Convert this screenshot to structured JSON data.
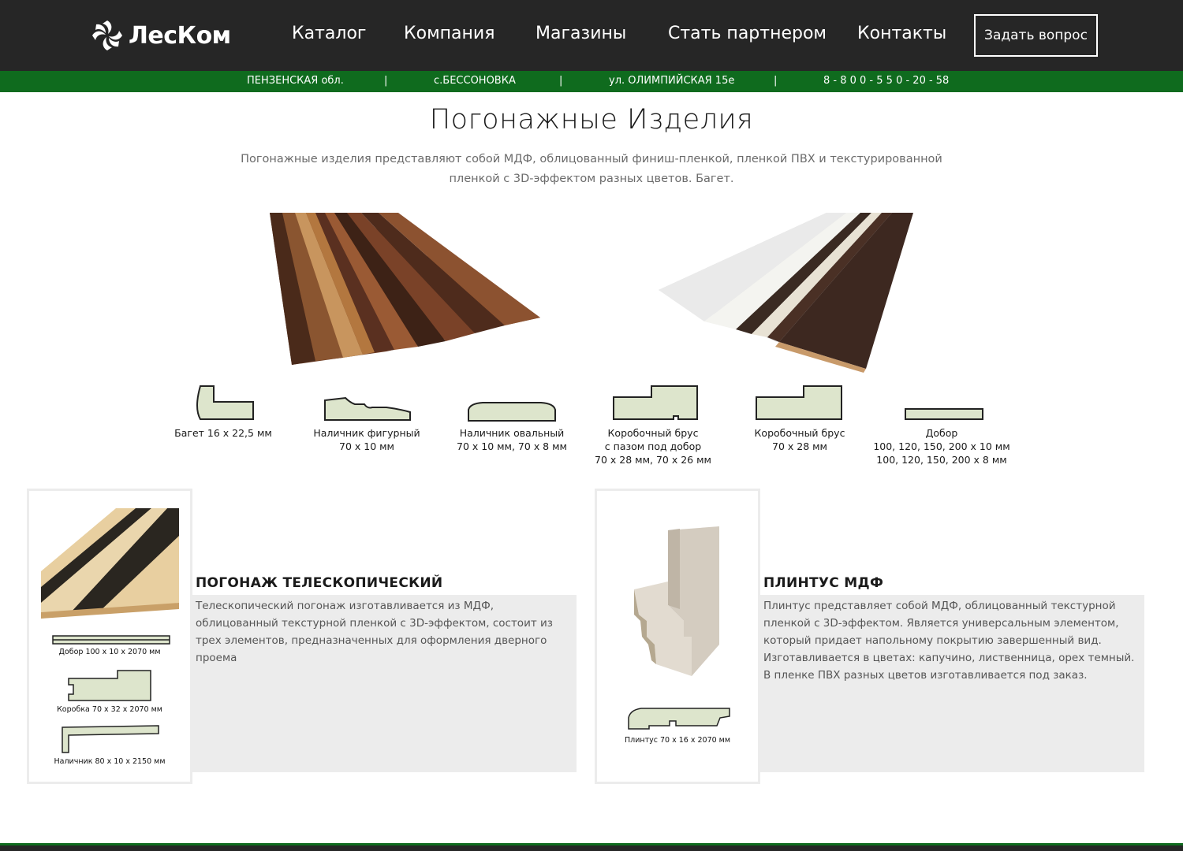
{
  "brand": {
    "name": "ЛесКом"
  },
  "nav": {
    "items": [
      "Каталог",
      "Компания",
      "Магазины",
      "Стать партнером",
      "Контакты"
    ],
    "ask_button": "Задать вопрос"
  },
  "infobar": {
    "region": "ПЕНЗЕНСКАЯ обл.",
    "separator": "|",
    "village": "с.БЕССОНОВКА",
    "street": "ул. ОЛИМПИЙСКАЯ 15е",
    "phone": "8 - 8 0 0 - 5 5 0 - 20 - 58"
  },
  "page": {
    "title": "Погонажные Изделия",
    "intro": "Погонажные изделия представляют собой МДФ, облицованный финиш-пленкой, пленкой ПВХ и текстурированной пленкой с 3D-эффектом разных цветов. Багет."
  },
  "profiles": [
    {
      "label": "Багет 16 х 22,5 мм"
    },
    {
      "label": "Наличник фигурный\n70 х 10 мм"
    },
    {
      "label": "Наличник овальный\n70 х 10 мм, 70 х 8 мм"
    },
    {
      "label": "Коробочный брус\nс пазом под добор\n70 х 28 мм, 70 х 26 мм"
    },
    {
      "label": "Коробочный брус\n70 х 28 мм"
    },
    {
      "label": "Добор\n100, 120, 150, 200 х 10 мм\n100, 120, 150, 200 х 8 мм"
    }
  ],
  "cards": [
    {
      "title": "ПОГОНАЖ ТЕЛЕСКОПИЧЕСКИЙ",
      "text": "Телескопический погонаж изготавливается из МДФ, облицованный текстурной пленкой с 3D-эффектом, состоит из трех элементов, предназначенных для оформления дверного проема",
      "labels": [
        "Добор 100 х 10 х 2070 мм",
        "Коробка 70 х 32 х 2070 мм",
        "Наличник 80 х 10 х 2150 мм"
      ]
    },
    {
      "title": "ПЛИНТУС МДФ",
      "text": "Плинтус представляет собой МДФ, облицованный текстурной пленкой с 3D-эффектом. Является универсальным элементом, который придает напольному покрытию завершенный вид. Изготавливается в цветах: капучино, лиственница, орех темный. В пленке ПВХ разных цветов изготавливается под заказ.",
      "labels": [
        "Плинтус 70 х 16 х 2070 мм"
      ]
    }
  ],
  "colors": {
    "header_bg": "#262626",
    "infobar_bg": "#0f6b1e",
    "profile_fill": "#dde5cc",
    "card_bg": "#ececec"
  }
}
